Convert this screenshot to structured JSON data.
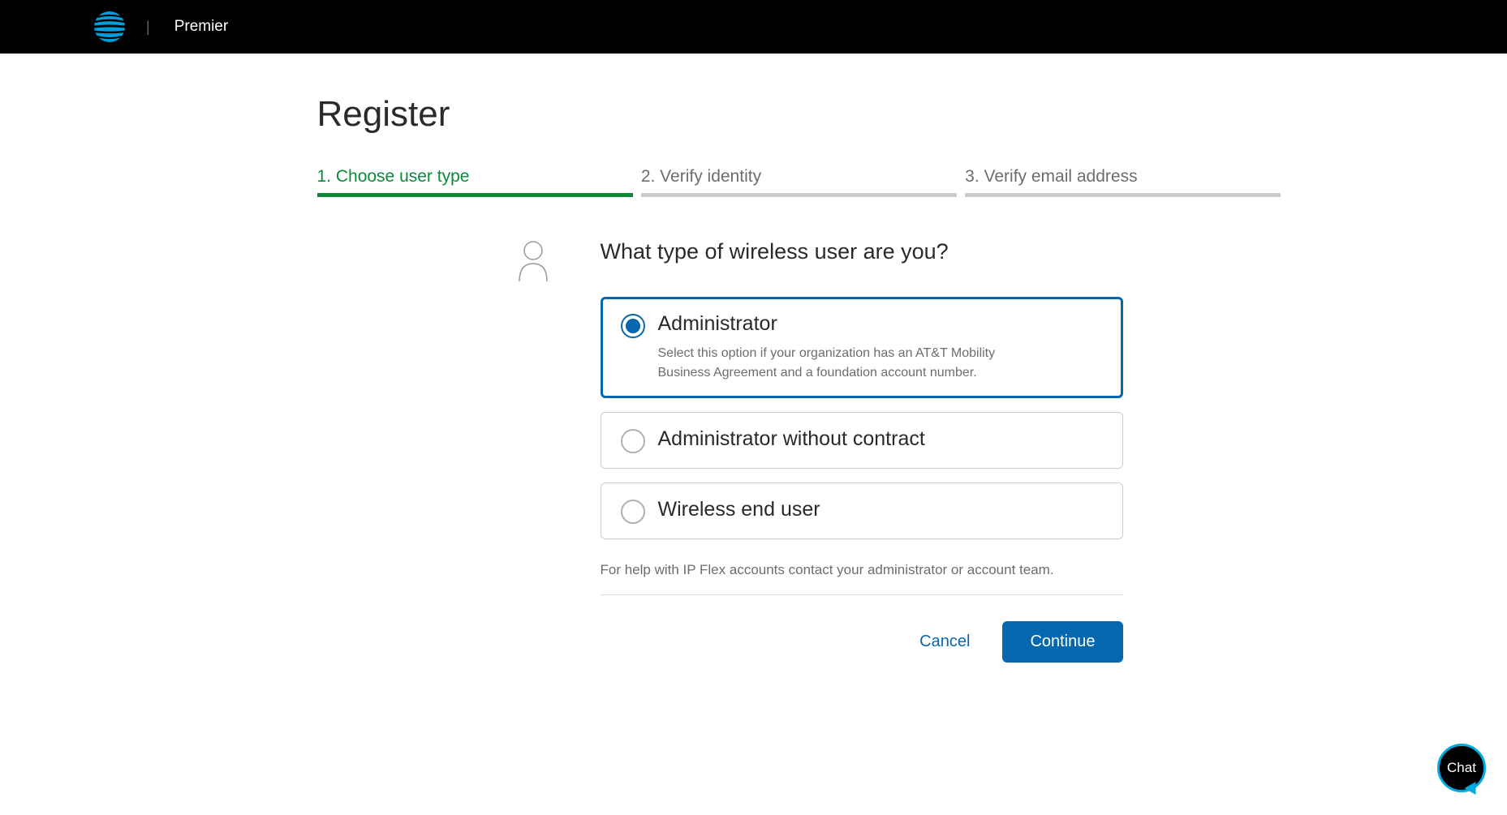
{
  "header": {
    "brand": "Premier"
  },
  "page": {
    "title": "Register"
  },
  "steps": [
    {
      "label": "1. Choose user type",
      "active": true
    },
    {
      "label": "2. Verify identity",
      "active": false
    },
    {
      "label": "3. Verify email address",
      "active": false
    }
  ],
  "form": {
    "question": "What type of wireless user are you?",
    "options": [
      {
        "title": "Administrator",
        "description": "Select this option if your organization has an AT&T Mobility Business Agreement and a foundation account number.",
        "selected": true
      },
      {
        "title": "Administrator without contract",
        "description": "",
        "selected": false
      },
      {
        "title": "Wireless end user",
        "description": "",
        "selected": false
      }
    ],
    "helpText": "For help with IP Flex accounts contact your administrator or account team."
  },
  "actions": {
    "cancel": "Cancel",
    "continue": "Continue"
  },
  "chat": {
    "label": "Chat"
  }
}
